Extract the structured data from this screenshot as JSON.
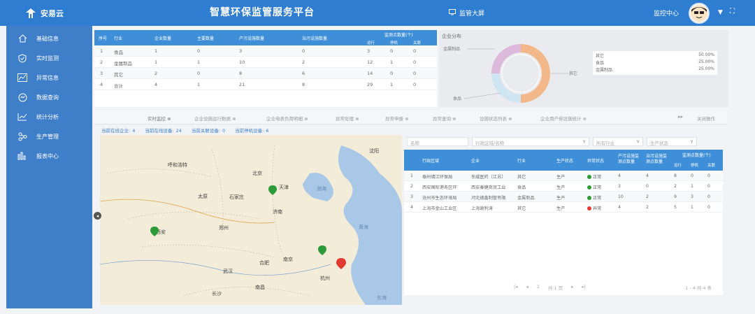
{
  "header": {
    "logo_text": "安易云",
    "title": "智慧环保监管服务平台",
    "big_screen_label": "监管大屏",
    "monitor_center_label": "监控中心"
  },
  "sidebar": {
    "items": [
      {
        "label": "基础信息",
        "icon": "home-icon"
      },
      {
        "label": "实时监测",
        "icon": "shield-icon"
      },
      {
        "label": "异常信息",
        "icon": "chart-alert-icon"
      },
      {
        "label": "数据查询",
        "icon": "search-icon"
      },
      {
        "label": "统计分析",
        "icon": "line-chart-icon"
      },
      {
        "label": "生产管理",
        "icon": "share-icon"
      },
      {
        "label": "报表中心",
        "icon": "bar-chart-icon"
      }
    ]
  },
  "summary_table": {
    "headers": [
      "序号",
      "行业",
      "企业数量",
      "主要数量",
      "产污设施数量",
      "治污设施数量",
      "监测点数量(个)"
    ],
    "sub_headers": [
      "运行",
      "停机",
      "关联"
    ],
    "rows": [
      [
        "1",
        "食品",
        "1",
        "0",
        "3",
        "0",
        "3",
        "0",
        "0"
      ],
      [
        "2",
        "金属制品",
        "1",
        "1",
        "10",
        "2",
        "12",
        "1",
        "0"
      ],
      [
        "3",
        "其它",
        "2",
        "0",
        "8",
        "6",
        "14",
        "0",
        "0"
      ],
      [
        "4",
        "合计",
        "4",
        "1",
        "21",
        "8",
        "29",
        "1",
        "0"
      ]
    ]
  },
  "distribution": {
    "title": "企业分布",
    "callouts": [
      "金属制品",
      "其它",
      "食品"
    ],
    "legend": [
      {
        "name": "其它",
        "value": "50.00%",
        "color": "#f2b88a"
      },
      {
        "name": "食品",
        "value": "25.00%",
        "color": "#cfe6f2"
      },
      {
        "name": "金属制品",
        "value": "25.00%",
        "color": "#dcb8da"
      }
    ]
  },
  "chart_data": {
    "type": "pie",
    "title": "企业分布",
    "categories": [
      "其它",
      "食品",
      "金属制品"
    ],
    "values": [
      50,
      25,
      25
    ],
    "unit": "%"
  },
  "tabs": [
    {
      "label": "实时监控",
      "active": true
    },
    {
      "label": "企业设施运行数据"
    },
    {
      "label": "企业电表负荷明细"
    },
    {
      "label": "异常处理"
    },
    {
      "label": "异常申报"
    },
    {
      "label": "异常查询"
    },
    {
      "label": "设施状态列表"
    },
    {
      "label": "企业用产排设施统计"
    }
  ],
  "tab_actions": {
    "more": "▸▸",
    "close_all": "关闭操作"
  },
  "stats": [
    {
      "label": "当前在线企业:",
      "value": "4"
    },
    {
      "label": "当前在线设备:",
      "value": "24"
    },
    {
      "label": "当前关联设备:",
      "value": "0"
    },
    {
      "label": "当前停机设备:",
      "value": "6"
    }
  ],
  "map_labels": [
    {
      "text": "呼和浩特",
      "type": "city"
    },
    {
      "text": "北京",
      "type": "city"
    },
    {
      "text": "天津",
      "type": "city"
    },
    {
      "text": "沈阳",
      "type": "city"
    },
    {
      "text": "太原",
      "type": "city"
    },
    {
      "text": "石家庄",
      "type": "city"
    },
    {
      "text": "济南",
      "type": "city"
    },
    {
      "text": "郑州",
      "type": "city"
    },
    {
      "text": "西安",
      "type": "city"
    },
    {
      "text": "南京",
      "type": "city"
    },
    {
      "text": "合肥",
      "type": "city"
    },
    {
      "text": "武汉",
      "type": "city"
    },
    {
      "text": "杭州",
      "type": "city"
    },
    {
      "text": "长沙",
      "type": "city"
    },
    {
      "text": "南昌",
      "type": "city"
    },
    {
      "text": "渤海",
      "type": "sea"
    },
    {
      "text": "黄海",
      "type": "sea"
    },
    {
      "text": "东海",
      "type": "sea"
    }
  ],
  "filters": {
    "name_placeholder": "名称",
    "facility_placeholder": "行政区域/名称",
    "industry_placeholder": "所有行业",
    "status_placeholder": "生产状态"
  },
  "enterprise_table": {
    "headers": [
      "行政区域",
      "企业",
      "行业",
      "生产状态",
      "异常状态",
      "产污设施监测点数量",
      "治污设施监测点数量",
      "监测点数量(个)"
    ],
    "sub_headers": [
      "运行",
      "停机",
      "关联"
    ],
    "rows": [
      {
        "no": "1",
        "region": "泰州靖江环保局",
        "name": "东威医药（江苏）",
        "industry": "其它",
        "prod": "生产",
        "status": "正常",
        "status_color": "#2d9b3a",
        "p": "4",
        "t": "4",
        "run": "8",
        "stop": "0",
        "link": "0"
      },
      {
        "no": "2",
        "region": "西安国际港务区环",
        "name": "西安秦健商贸工业",
        "industry": "食品",
        "prod": "生产",
        "status": "正常",
        "status_color": "#2d9b3a",
        "p": "3",
        "t": "0",
        "run": "2",
        "stop": "1",
        "link": "0"
      },
      {
        "no": "3",
        "region": "沧州市生态环境局",
        "name": "河北德鑫制管有限",
        "industry": "金属制品",
        "prod": "生产",
        "status": "正常",
        "status_color": "#2d9b3a",
        "p": "10",
        "t": "2",
        "run": "9",
        "stop": "3",
        "link": "0"
      },
      {
        "no": "4",
        "region": "上海市金山工业区",
        "name": "上海谢利涛",
        "industry": "其它",
        "prod": "生产",
        "status": "异常",
        "status_color": "#e23a2e",
        "p": "4",
        "t": "2",
        "run": "5",
        "stop": "1",
        "link": "0"
      }
    ]
  },
  "pager": {
    "first": "|◂",
    "prev": "◂",
    "page": "1",
    "total": "共 1 页",
    "next": "▸",
    "last": "▸|",
    "info": "1 - 4  共 4 条"
  }
}
